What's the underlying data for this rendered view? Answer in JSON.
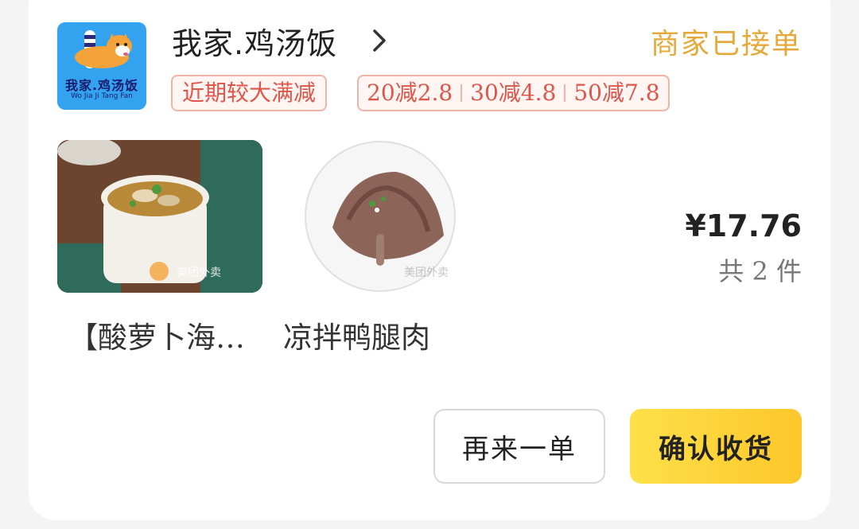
{
  "store": {
    "name": "我家.鸡汤饭",
    "logo_text": "我家.鸡汤饭",
    "logo_subtext": "Wo Jia Ji Tang Fan",
    "status": "商家已接单"
  },
  "promotions": {
    "tag": "近期较大满减",
    "deals": [
      "20减2.8",
      "30减4.8",
      "50减7.8"
    ]
  },
  "products": [
    {
      "name": "【酸萝卜海…",
      "image_icon": "soup-photo",
      "watermark": "美团外卖"
    },
    {
      "name": "凉拌鸭腿肉",
      "image_icon": "duck-photo",
      "watermark": "美团外卖"
    }
  ],
  "summary": {
    "price": "¥17.76",
    "count": "共 2 件"
  },
  "actions": {
    "reorder": "再来一单",
    "confirm": "确认收货"
  },
  "colors": {
    "status": "#e6a83a",
    "promo": "#e05548",
    "confirm_button": "#fdd23a",
    "logo_bg": "#33a3f0"
  }
}
